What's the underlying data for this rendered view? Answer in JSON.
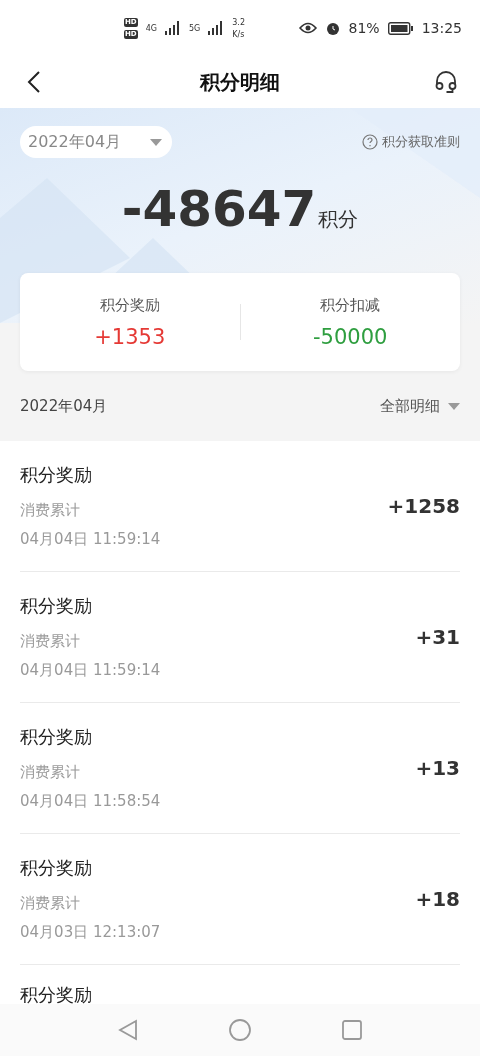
{
  "status_bar": {
    "sim_badges": [
      "HD",
      "HD"
    ],
    "networks": [
      "4G",
      "5G"
    ],
    "speed": [
      "3.2",
      "K/s"
    ],
    "battery": "81%",
    "time": "13:25"
  },
  "header": {
    "title": "积分明细"
  },
  "summary": {
    "month": "2022年04月",
    "rules_link": "积分获取准则",
    "total": "-48647",
    "unit": "积分",
    "stats": [
      {
        "label": "积分奖励",
        "value": "+1353",
        "color": "#e53935"
      },
      {
        "label": "积分扣减",
        "value": "-50000",
        "color": "#2e9e3f"
      }
    ]
  },
  "filter": {
    "month": "2022年04月",
    "type": "全部明细"
  },
  "records": [
    {
      "title": "积分奖励",
      "source": "消费累计",
      "time": "04月04日 11:59:14",
      "points": "+1258"
    },
    {
      "title": "积分奖励",
      "source": "消费累计",
      "time": "04月04日 11:59:14",
      "points": "+31"
    },
    {
      "title": "积分奖励",
      "source": "消费累计",
      "time": "04月04日 11:58:54",
      "points": "+13"
    },
    {
      "title": "积分奖励",
      "source": "消费累计",
      "time": "04月03日 12:13:07",
      "points": "+18"
    },
    {
      "title": "积分奖励"
    }
  ]
}
